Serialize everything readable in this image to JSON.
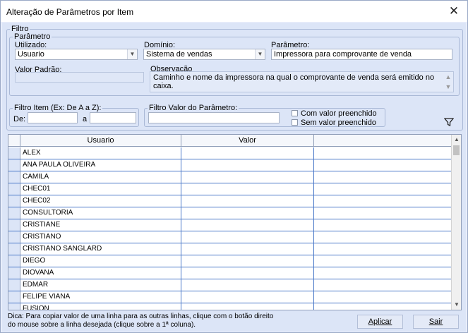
{
  "window": {
    "title": "Alteração de Parâmetros por Item",
    "close_icon": "close-icon"
  },
  "filtro": {
    "legend": "Filtro",
    "parametro_group": {
      "legend": "Parâmetro",
      "utilizado_label": "Utilizado:",
      "utilizado_value": "Usuario",
      "dominio_label": "Domínio:",
      "dominio_value": "Sistema de vendas",
      "parametro_label": "Parâmetro:",
      "parametro_value": "Impressora para comprovante de venda",
      "valor_padrao_label": "Valor Padrão:",
      "valor_padrao_value": "",
      "observacao_label": "Observação",
      "observacao_text": "Caminho e nome da impressora na qual o comprovante de venda será emitido no caixa."
    },
    "filtro_item": {
      "legend": "Filtro Item (Ex: De A a Z):",
      "de_label": "De:",
      "de_value": "",
      "a_label": "a",
      "a_value": ""
    },
    "filtro_valor": {
      "legend": "Filtro Valor do Parâmetro:",
      "value": "",
      "com_valor_label": "Com valor preenchido",
      "com_valor_checked": false,
      "sem_valor_label": "Sem valor preenchido",
      "sem_valor_checked": false
    },
    "filter_icon": "funnel-icon"
  },
  "grid": {
    "columns": [
      "Usuario",
      "Valor",
      ""
    ],
    "rows": [
      {
        "usuario": "ALEX",
        "valor": ""
      },
      {
        "usuario": "ANA PAULA OLIVEIRA",
        "valor": ""
      },
      {
        "usuario": "CAMILA",
        "valor": ""
      },
      {
        "usuario": "CHEC01",
        "valor": ""
      },
      {
        "usuario": "CHEC02",
        "valor": ""
      },
      {
        "usuario": "CONSULTORIA",
        "valor": ""
      },
      {
        "usuario": "CRISTIANE",
        "valor": ""
      },
      {
        "usuario": "CRISTIANO",
        "valor": ""
      },
      {
        "usuario": "CRISTIANO SANGLARD",
        "valor": ""
      },
      {
        "usuario": "DIEGO",
        "valor": ""
      },
      {
        "usuario": "DIOVANA",
        "valor": ""
      },
      {
        "usuario": "EDMAR",
        "valor": ""
      },
      {
        "usuario": "FELIPE VIANA",
        "valor": ""
      },
      {
        "usuario": "FUSION",
        "valor": ""
      }
    ]
  },
  "footer": {
    "hint": "Dica: Para copiar valor de uma linha para as outras linhas, clique com o botão direito do mouse sobre a linha desejada (clique sobre a 1ª coluna).",
    "aplicar_label": "Aplicar",
    "sair_label": "Sair"
  }
}
